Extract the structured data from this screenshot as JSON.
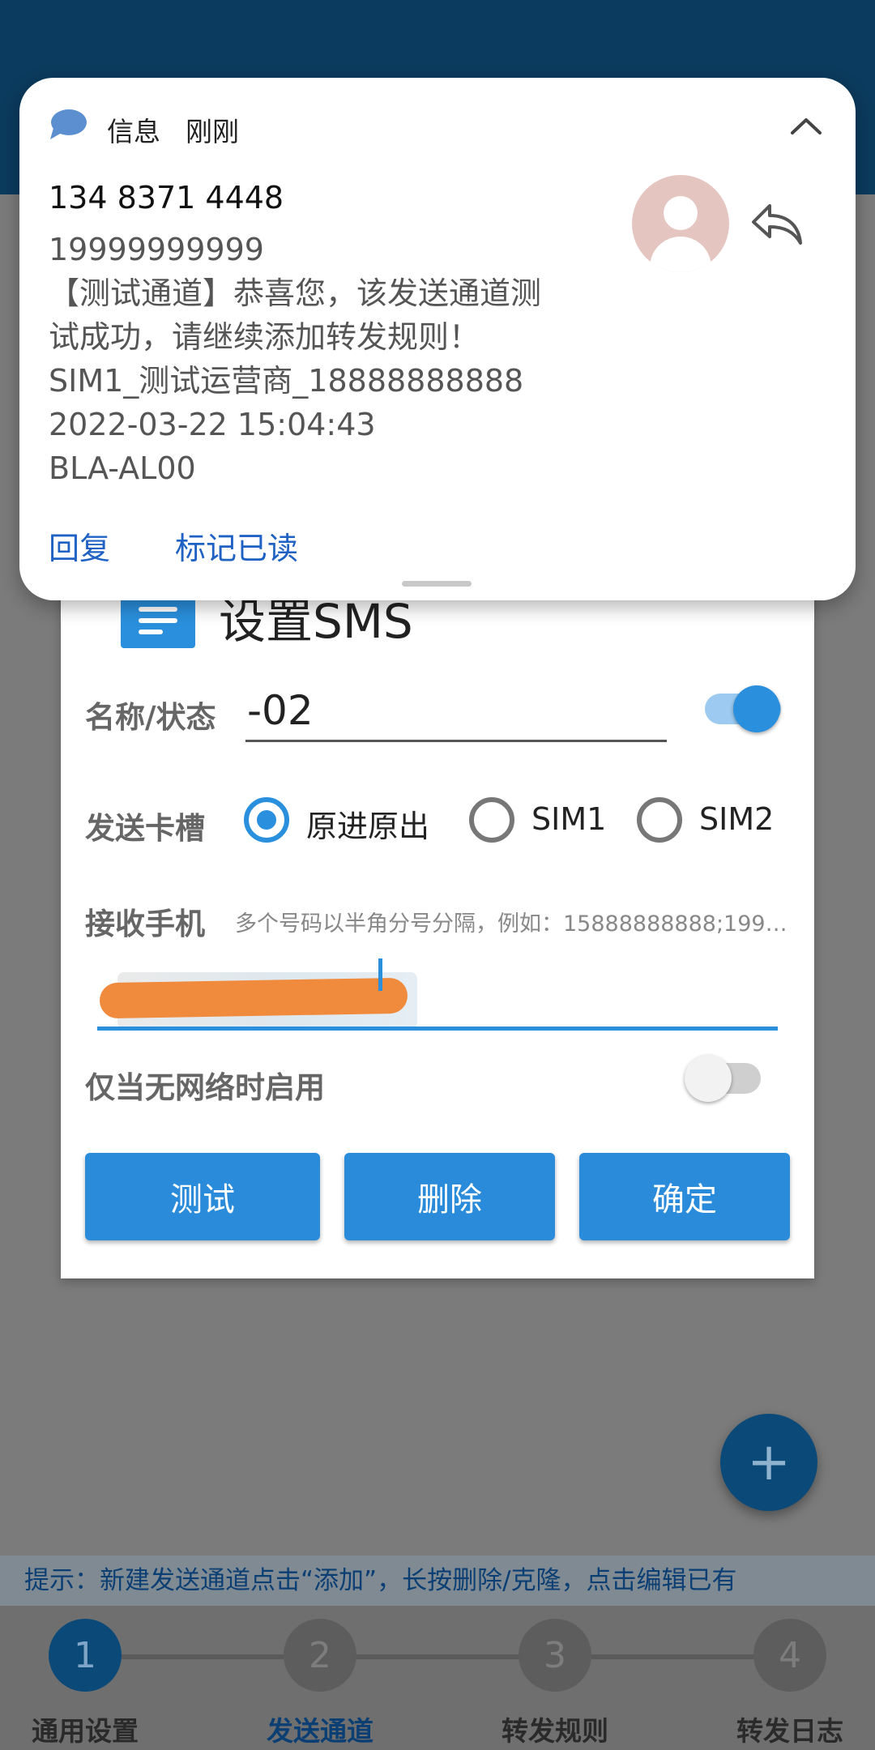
{
  "notification": {
    "app_name": "信息",
    "time": "刚刚",
    "sender": "134 8371 4448",
    "body_lines": [
      "19999999999",
      "【测试通道】恭喜您，该发送通道测",
      "试成功，请继续添加转发规则！",
      "SIM1_测试运营商_18888888888",
      "2022-03-22 15:04:43",
      "BLA-AL00"
    ],
    "actions": [
      "回复",
      "标记已读"
    ],
    "icons": {
      "app": "message-bubble-icon",
      "collapse": "chevron-up-icon",
      "avatar": "person-avatar-icon",
      "reply": "reply-icon"
    }
  },
  "dialog": {
    "title": "设置SMS",
    "name_label": "名称/状态",
    "name_value": "-02",
    "name_enabled": true,
    "slot_label": "发送卡槽",
    "slot_options": [
      "原进原出",
      "SIM1",
      "SIM2"
    ],
    "slot_selected": "原进原出",
    "phone_label": "接收手机",
    "phone_hint": "多个号码以半角分号分隔，例如：15888888888;19999999999",
    "offline_label": "仅当无网络时启用",
    "offline_enabled": false,
    "buttons": {
      "test": "测试",
      "delete": "删除",
      "confirm": "确定"
    }
  },
  "fab": {
    "icon": "plus-icon",
    "label": "+"
  },
  "hint": "提示：新建发送通道点击“添加”，长按删除/克隆，点击编辑已有",
  "steps": [
    {
      "number": "1",
      "label": "通用设置"
    },
    {
      "number": "2",
      "label": "发送通道"
    },
    {
      "number": "3",
      "label": "转发规则"
    },
    {
      "number": "4",
      "label": "转发日志"
    }
  ],
  "colors": {
    "accent": "#2a8bdb",
    "link": "#1f62c4",
    "topbar": "#0b3b5e"
  }
}
